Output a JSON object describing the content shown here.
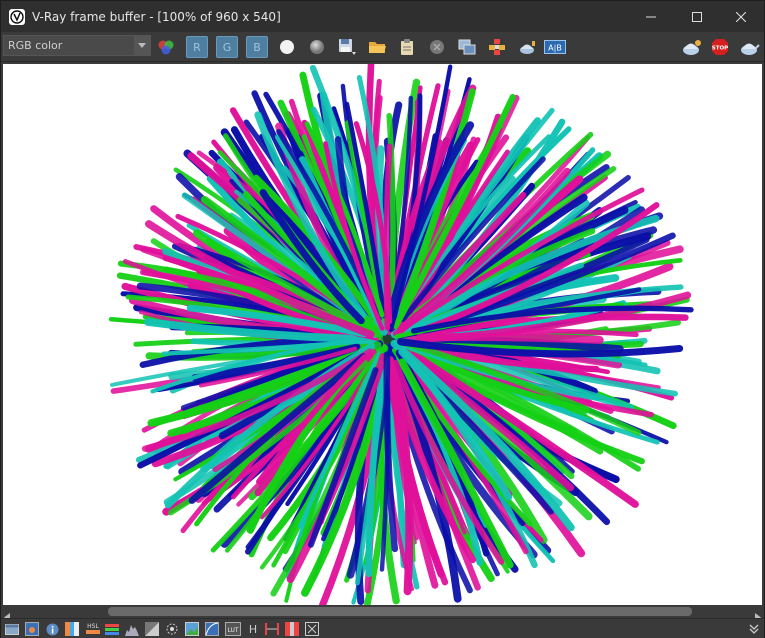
{
  "window": {
    "title": "V-Ray frame buffer - [100% of 960 x 540]",
    "minimize_icon": "minimize-icon",
    "maximize_icon": "maximize-icon",
    "close_icon": "close-icon"
  },
  "toolbar": {
    "channel": {
      "selected": "RGB color"
    },
    "channels": {
      "r": "R",
      "g": "G",
      "b": "B"
    },
    "icons": [
      "color-correction-icon",
      "red-channel",
      "green-channel",
      "blue-channel",
      "white-circle-icon",
      "gray-circle-icon",
      "save-icon",
      "open-folder-icon",
      "clipboard-icon",
      "clear-image-icon",
      "duplicate-icon",
      "track-mouse-icon",
      "render-region-icon",
      "compare-ab-icon",
      "interactive-render-icon",
      "stop-render-icon",
      "render-teapot-icon"
    ],
    "stop_label": "STOP",
    "ab_label": "A|B"
  },
  "statusbar": {
    "icons": [
      "show-history-icon",
      "display-color-icon",
      "info-icon",
      "lut-icon",
      "hsl-icon",
      "levels-icon",
      "histogram-icon",
      "exposure-icon",
      "lens-effects-icon",
      "image-icon",
      "curve-icon",
      "lut-file-icon",
      "h-icon",
      "hsv-icon",
      "color-bars-icon",
      "pixel-info-icon",
      "expand-icon"
    ],
    "hsl_label": "HSL",
    "lut_label": "LUT",
    "h_label": "H"
  },
  "render": {
    "colors": {
      "magenta": "#e0109a",
      "teal": "#13c3b4",
      "green": "#15d015",
      "blue": "#0b0fa8",
      "background": "#ffffff",
      "core": "#0a2a1a"
    }
  }
}
